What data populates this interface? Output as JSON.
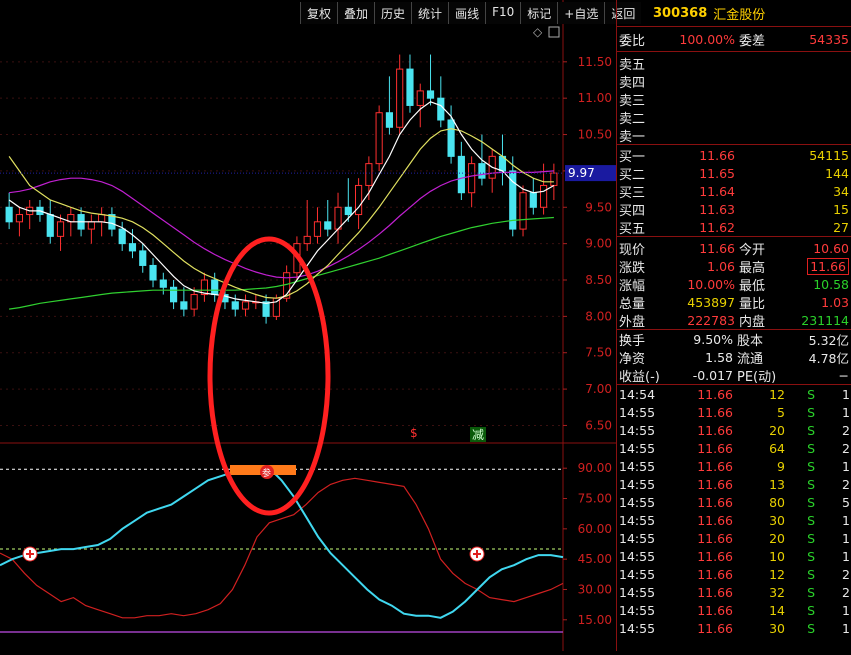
{
  "toolbar": [
    "复权",
    "叠加",
    "历史",
    "统计",
    "画线",
    "F10",
    "标记",
    "+自选",
    "返回"
  ],
  "stock": {
    "code": "300368",
    "name": "汇金股份"
  },
  "weibi": {
    "label": "委比",
    "value": "100.00%",
    "label2": "委差",
    "value2": "54335"
  },
  "sells": [
    {
      "label": "卖五"
    },
    {
      "label": "卖四"
    },
    {
      "label": "卖三"
    },
    {
      "label": "卖二"
    },
    {
      "label": "卖一"
    }
  ],
  "buys": [
    {
      "label": "买一",
      "price": "11.66",
      "vol": "54115"
    },
    {
      "label": "买二",
      "price": "11.65",
      "vol": "144"
    },
    {
      "label": "买三",
      "price": "11.64",
      "vol": "34"
    },
    {
      "label": "买四",
      "price": "11.63",
      "vol": "15"
    },
    {
      "label": "买五",
      "price": "11.62",
      "vol": "27"
    }
  ],
  "stats": [
    {
      "l1": "现价",
      "v1": "11.66",
      "l2": "今开",
      "v2": "10.60",
      "c1": "red",
      "c2": "red",
      "box": false
    },
    {
      "l1": "涨跌",
      "v1": "1.06",
      "l2": "最高",
      "v2": "11.66",
      "c1": "red",
      "c2": "red",
      "box": true
    },
    {
      "l1": "涨幅",
      "v1": "10.00%",
      "l2": "最低",
      "v2": "10.58",
      "c1": "red",
      "c2": "green",
      "box": false
    },
    {
      "l1": "总量",
      "v1": "453897",
      "l2": "量比",
      "v2": "1.03",
      "c1": "yel",
      "c2": "red",
      "box": false
    },
    {
      "l1": "外盘",
      "v1": "222783",
      "l2": "内盘",
      "v2": "231114",
      "c1": "red",
      "c2": "green",
      "box": false
    }
  ],
  "stats2": [
    {
      "l1": "换手",
      "v1": "9.50%",
      "l2": "股本",
      "v2": "5.32亿"
    },
    {
      "l1": "净资",
      "v1": "1.58",
      "l2": "流通",
      "v2": "4.78亿"
    },
    {
      "l1": "收益(-)",
      "v1": "-0.017",
      "l2": "PE(动)",
      "v2": "−"
    }
  ],
  "ticks": [
    {
      "t": "14:54",
      "p": "11.66",
      "q": "12",
      "s": "S",
      "c": "1"
    },
    {
      "t": "14:55",
      "p": "11.66",
      "q": "5",
      "s": "S",
      "c": "1"
    },
    {
      "t": "14:55",
      "p": "11.66",
      "q": "20",
      "s": "S",
      "c": "2"
    },
    {
      "t": "14:55",
      "p": "11.66",
      "q": "64",
      "s": "S",
      "c": "2"
    },
    {
      "t": "14:55",
      "p": "11.66",
      "q": "9",
      "s": "S",
      "c": "1"
    },
    {
      "t": "14:55",
      "p": "11.66",
      "q": "13",
      "s": "S",
      "c": "2"
    },
    {
      "t": "14:55",
      "p": "11.66",
      "q": "80",
      "s": "S",
      "c": "5"
    },
    {
      "t": "14:55",
      "p": "11.66",
      "q": "30",
      "s": "S",
      "c": "1"
    },
    {
      "t": "14:55",
      "p": "11.66",
      "q": "20",
      "s": "S",
      "c": "1"
    },
    {
      "t": "14:55",
      "p": "11.66",
      "q": "10",
      "s": "S",
      "c": "1"
    },
    {
      "t": "14:55",
      "p": "11.66",
      "q": "12",
      "s": "S",
      "c": "2"
    },
    {
      "t": "14:55",
      "p": "11.66",
      "q": "32",
      "s": "S",
      "c": "2"
    },
    {
      "t": "14:55",
      "p": "11.66",
      "q": "14",
      "s": "S",
      "c": "1"
    },
    {
      "t": "14:55",
      "p": "11.66",
      "q": "30",
      "s": "S",
      "c": "1"
    }
  ],
  "price_axis": [
    "11.50",
    "11.00",
    "10.50",
    "10.00",
    "9.50",
    "9.00",
    "8.50",
    "8.00",
    "7.50",
    "7.00",
    "6.50"
  ],
  "osc_axis": [
    "90.00",
    "75.00",
    "60.00",
    "45.00",
    "30.00",
    "15.00"
  ],
  "marker_price": "9.97",
  "signals": {
    "left": "$",
    "right": "减",
    "osc_label": "参"
  },
  "chart_data": {
    "type": "candlestick",
    "ylim": [
      6.3,
      11.8
    ],
    "candles": [
      [
        9.5,
        9.7,
        9.2,
        9.3
      ],
      [
        9.3,
        9.5,
        9.1,
        9.4
      ],
      [
        9.4,
        9.6,
        9.2,
        9.5
      ],
      [
        9.5,
        9.6,
        9.3,
        9.4
      ],
      [
        9.4,
        9.6,
        9.0,
        9.1
      ],
      [
        9.1,
        9.4,
        8.9,
        9.3
      ],
      [
        9.3,
        9.5,
        9.1,
        9.4
      ],
      [
        9.4,
        9.5,
        9.1,
        9.2
      ],
      [
        9.2,
        9.4,
        9.0,
        9.3
      ],
      [
        9.3,
        9.5,
        9.1,
        9.4
      ],
      [
        9.4,
        9.5,
        9.1,
        9.2
      ],
      [
        9.2,
        9.3,
        8.9,
        9.0
      ],
      [
        9.0,
        9.2,
        8.8,
        8.9
      ],
      [
        8.9,
        9.0,
        8.6,
        8.7
      ],
      [
        8.7,
        8.8,
        8.4,
        8.5
      ],
      [
        8.5,
        8.6,
        8.3,
        8.4
      ],
      [
        8.4,
        8.5,
        8.1,
        8.2
      ],
      [
        8.2,
        8.4,
        8.0,
        8.1
      ],
      [
        8.1,
        8.4,
        8.0,
        8.3
      ],
      [
        8.3,
        8.6,
        8.2,
        8.5
      ],
      [
        8.5,
        8.6,
        8.2,
        8.3
      ],
      [
        8.3,
        8.4,
        8.1,
        8.2
      ],
      [
        8.2,
        8.3,
        8.0,
        8.1
      ],
      [
        8.1,
        8.3,
        8.0,
        8.2
      ],
      [
        8.2,
        8.3,
        8.1,
        8.2
      ],
      [
        8.2,
        8.3,
        7.9,
        8.0
      ],
      [
        8.0,
        8.3,
        7.95,
        8.25
      ],
      [
        8.25,
        8.7,
        8.2,
        8.6
      ],
      [
        8.6,
        9.1,
        8.5,
        9.0
      ],
      [
        9.0,
        9.6,
        8.9,
        9.1
      ],
      [
        9.1,
        9.5,
        9.0,
        9.3
      ],
      [
        9.3,
        9.6,
        9.1,
        9.2
      ],
      [
        9.2,
        9.7,
        9.0,
        9.5
      ],
      [
        9.5,
        9.9,
        9.3,
        9.4
      ],
      [
        9.4,
        9.9,
        9.2,
        9.8
      ],
      [
        9.8,
        10.2,
        9.6,
        10.1
      ],
      [
        10.1,
        10.9,
        10.0,
        10.8
      ],
      [
        10.8,
        11.3,
        10.5,
        10.6
      ],
      [
        10.6,
        11.6,
        10.5,
        11.4
      ],
      [
        11.4,
        11.6,
        10.8,
        10.9
      ],
      [
        10.9,
        11.2,
        10.6,
        11.1
      ],
      [
        11.1,
        11.6,
        10.9,
        11.0
      ],
      [
        11.0,
        11.3,
        10.6,
        10.7
      ],
      [
        10.7,
        10.9,
        10.1,
        10.2
      ],
      [
        10.2,
        10.4,
        9.6,
        9.7
      ],
      [
        9.7,
        10.2,
        9.5,
        10.1
      ],
      [
        10.1,
        10.5,
        9.8,
        9.9
      ],
      [
        9.9,
        10.3,
        9.7,
        10.2
      ],
      [
        10.2,
        10.5,
        9.8,
        10.0
      ],
      [
        10.0,
        10.2,
        9.1,
        9.2
      ],
      [
        9.2,
        9.8,
        9.1,
        9.7
      ],
      [
        9.7,
        9.9,
        9.4,
        9.5
      ],
      [
        9.5,
        10.1,
        9.4,
        9.8
      ],
      [
        9.8,
        10.1,
        9.6,
        9.97
      ]
    ],
    "ma_white": [
      9.6,
      9.5,
      9.45,
      9.45,
      9.4,
      9.35,
      9.3,
      9.3,
      9.3,
      9.3,
      9.28,
      9.22,
      9.12,
      9.0,
      8.85,
      8.7,
      8.55,
      8.42,
      8.35,
      8.32,
      8.3,
      8.28,
      8.24,
      8.22,
      8.2,
      8.18,
      8.2,
      8.3,
      8.5,
      8.7,
      8.9,
      9.05,
      9.2,
      9.35,
      9.5,
      9.7,
      9.95,
      10.2,
      10.5,
      10.7,
      10.85,
      10.95,
      10.9,
      10.75,
      10.5,
      10.3,
      10.15,
      10.05,
      10.0,
      9.85,
      9.75,
      9.7,
      9.72,
      9.8
    ],
    "ma_yellow": [
      10.2,
      10.0,
      9.8,
      9.7,
      9.6,
      9.55,
      9.5,
      9.45,
      9.42,
      9.4,
      9.38,
      9.35,
      9.3,
      9.22,
      9.12,
      9.0,
      8.88,
      8.76,
      8.66,
      8.58,
      8.52,
      8.46,
      8.4,
      8.35,
      8.3,
      8.26,
      8.25,
      8.28,
      8.35,
      8.45,
      8.58,
      8.7,
      8.85,
      9.0,
      9.15,
      9.32,
      9.5,
      9.7,
      9.9,
      10.1,
      10.3,
      10.45,
      10.55,
      10.58,
      10.55,
      10.48,
      10.4,
      10.3,
      10.2,
      10.08,
      9.98,
      9.9,
      9.85,
      9.85
    ],
    "ma_purple": [
      9.7,
      9.72,
      9.75,
      9.8,
      9.85,
      9.88,
      9.9,
      9.9,
      9.88,
      9.85,
      9.8,
      9.72,
      9.62,
      9.52,
      9.42,
      9.32,
      9.22,
      9.12,
      9.02,
      8.93,
      8.85,
      8.78,
      8.72,
      8.66,
      8.61,
      8.57,
      8.54,
      8.53,
      8.54,
      8.57,
      8.62,
      8.68,
      8.75,
      8.83,
      8.92,
      9.02,
      9.13,
      9.25,
      9.38,
      9.5,
      9.62,
      9.72,
      9.8,
      9.86,
      9.9,
      9.93,
      9.95,
      9.97,
      9.98,
      9.98,
      9.98,
      9.98,
      9.99,
      10.0
    ],
    "ma_green": [
      8.1,
      8.12,
      8.15,
      8.18,
      8.2,
      8.22,
      8.24,
      8.26,
      8.28,
      8.3,
      8.32,
      8.33,
      8.34,
      8.35,
      8.36,
      8.36,
      8.36,
      8.36,
      8.36,
      8.36,
      8.36,
      8.36,
      8.36,
      8.37,
      8.38,
      8.39,
      8.41,
      8.44,
      8.48,
      8.52,
      8.56,
      8.6,
      8.64,
      8.68,
      8.72,
      8.76,
      8.8,
      8.85,
      8.9,
      8.95,
      9.0,
      9.05,
      9.1,
      9.14,
      9.18,
      9.22,
      9.25,
      9.28,
      9.3,
      9.32,
      9.33,
      9.34,
      9.35,
      9.36
    ],
    "osc_ylim": [
      5,
      100
    ],
    "osc_cyan": [
      42,
      45,
      47,
      48,
      49,
      50,
      50,
      51,
      52,
      55,
      60,
      64,
      68,
      70,
      72,
      76,
      80,
      84,
      86,
      88,
      90,
      91,
      90,
      84,
      76,
      66,
      56,
      48,
      42,
      36,
      30,
      25,
      22,
      18,
      17,
      17,
      16,
      19,
      24,
      30,
      36,
      40,
      42,
      45,
      47,
      47,
      46
    ],
    "osc_red": [
      48,
      45,
      38,
      32,
      28,
      24,
      26,
      22,
      20,
      18,
      16,
      16,
      17,
      17,
      18,
      17,
      18,
      20,
      23,
      30,
      42,
      56,
      63,
      65,
      67,
      72,
      78,
      82,
      84,
      85,
      84,
      83,
      82,
      81,
      72,
      60,
      45,
      38,
      33,
      30,
      26,
      25,
      24,
      26,
      28,
      30,
      33
    ],
    "osc_levels": {
      "upper": 90,
      "mid": 50,
      "lower": 5
    }
  }
}
